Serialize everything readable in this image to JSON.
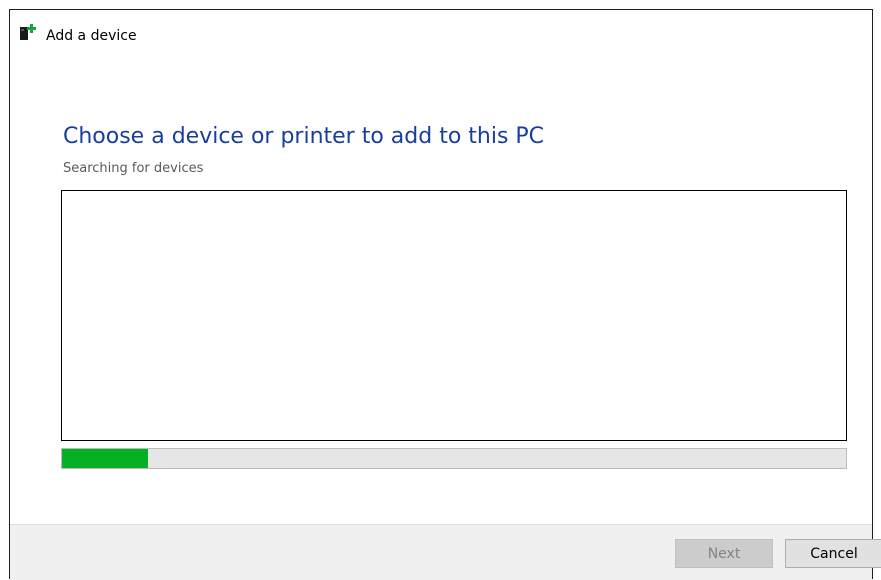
{
  "window": {
    "title": "Add a device"
  },
  "main": {
    "heading": "Choose a device or printer to add to this PC",
    "status": "Searching for devices",
    "device_list": [],
    "progress": {
      "value": 0.11,
      "color": "#06b025"
    }
  },
  "footer": {
    "next_label": "Next",
    "cancel_label": "Cancel"
  },
  "icons": {
    "title_icon": "add-device-icon"
  },
  "colors": {
    "heading": "#1a3e9e",
    "status_text": "#5a5a5a",
    "progress_fill": "#06b025"
  }
}
